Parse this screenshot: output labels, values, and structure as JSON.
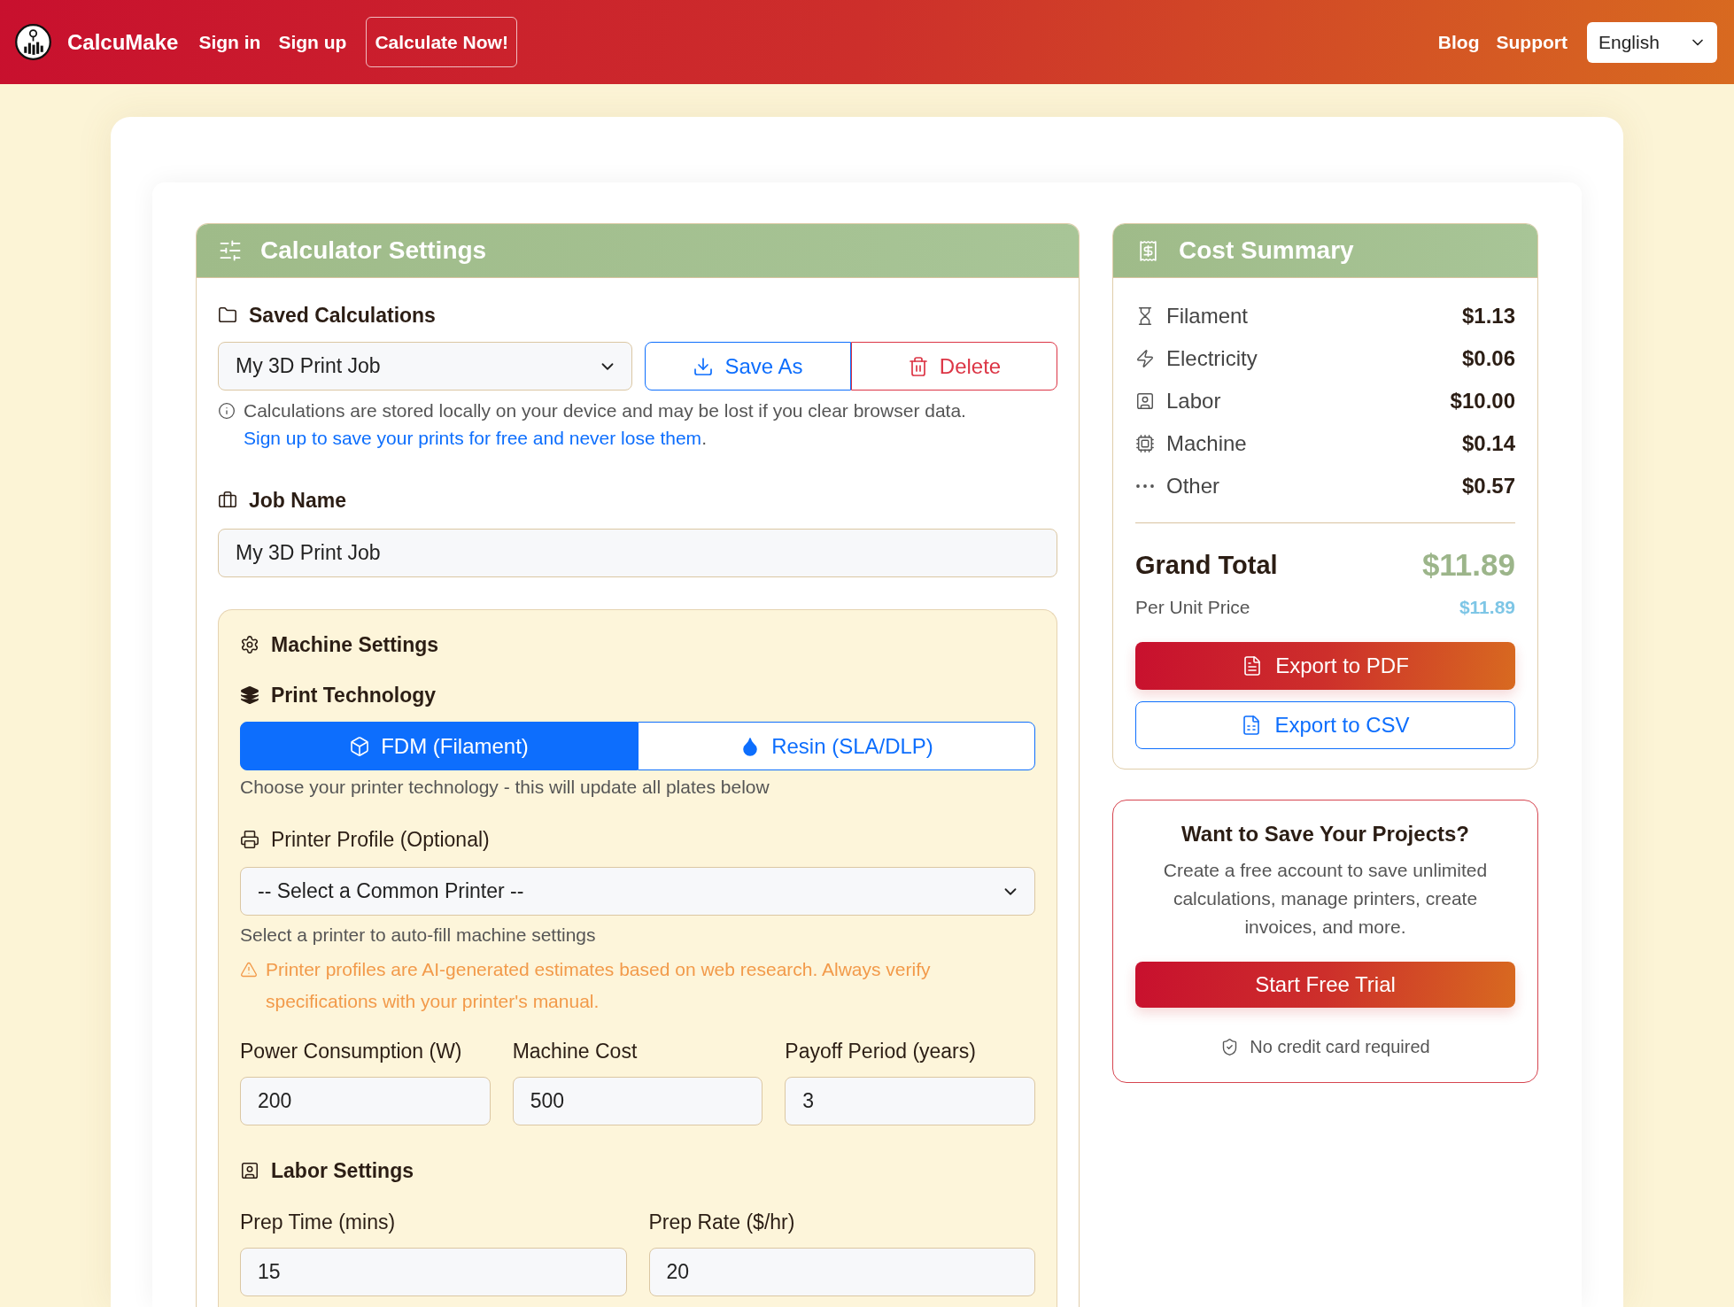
{
  "header": {
    "brand": "CalcuMake",
    "nav_links": [
      "Sign in",
      "Sign up"
    ],
    "cta_button": "Calculate Now!",
    "right_links": [
      "Blog",
      "Support"
    ],
    "language_select": {
      "value": "English"
    }
  },
  "calculator_settings": {
    "title": "Calculator Settings",
    "saved_calculations": {
      "heading": "Saved Calculations",
      "select_value": "My 3D Print Job",
      "buttons": [
        {
          "label": "Save As",
          "kind": "primary"
        },
        {
          "label": "Delete",
          "kind": "danger"
        }
      ],
      "notice": {
        "text": "Calculations are stored locally on your device and may be lost if you clear browser data.",
        "link": "Sign up to save your prints for free and never lose them",
        "end": "."
      }
    },
    "job_name": {
      "label": "Job Name",
      "value": "My 3D Print Job"
    },
    "machine_settings": {
      "heading": "Machine Settings",
      "print_technology": {
        "heading": "Print Technology",
        "options": [
          {
            "label": "FDM (Filament)",
            "selected": true
          },
          {
            "label": "Resin (SLA/DLP)",
            "selected": false
          }
        ],
        "help": "Choose your printer technology - this will update all plates below"
      },
      "printer_profile": {
        "label": "Printer Profile (Optional)",
        "select_value": "-- Select a Common Printer --",
        "help": "Select a printer to auto-fill machine settings",
        "warning": "Printer profiles are AI-generated estimates based on web research. Always verify specifications with your printer's manual."
      },
      "fields": [
        {
          "label": "Power Consumption (W)",
          "value": "200"
        },
        {
          "label": "Machine Cost",
          "value": "500"
        },
        {
          "label": "Payoff Period (years)",
          "value": "3"
        }
      ]
    },
    "labor_settings": {
      "heading": "Labor Settings",
      "fields": [
        {
          "label": "Prep Time (mins)",
          "value": "15"
        },
        {
          "label": "Prep Rate ($/hr)",
          "value": "20"
        }
      ]
    }
  },
  "cost_summary": {
    "title": "Cost Summary",
    "items": [
      {
        "label": "Filament",
        "value": "$1.13"
      },
      {
        "label": "Electricity",
        "value": "$0.06"
      },
      {
        "label": "Labor",
        "value": "$10.00"
      },
      {
        "label": "Machine",
        "value": "$0.14"
      },
      {
        "label": "Other",
        "value": "$0.57"
      }
    ],
    "grand_total": {
      "label": "Grand Total",
      "value": "$11.89"
    },
    "per_unit": {
      "label": "Per Unit Price",
      "value": "$11.89"
    },
    "buttons": [
      {
        "label": "Export to PDF",
        "kind": "gradient"
      },
      {
        "label": "Export to CSV",
        "kind": "outline"
      }
    ]
  },
  "signup_promo": {
    "title": "Want to Save Your Projects?",
    "text": "Create a free account to save unlimited calculations, manage printers, create invoices, and more.",
    "button": "Start Free Trial",
    "note": "No credit card required"
  }
}
